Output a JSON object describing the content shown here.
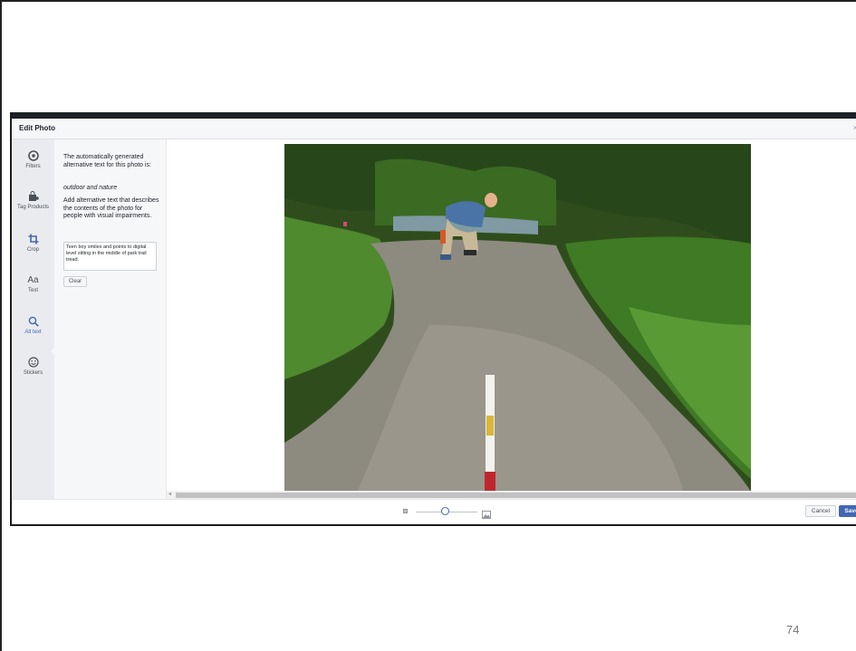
{
  "slide": {
    "number": "74"
  },
  "dialog": {
    "title": "Edit Photo",
    "close_glyph": "×"
  },
  "tools": [
    {
      "label": "Filters",
      "icon": "filters-icon"
    },
    {
      "label": "Tag Products",
      "icon": "shopping-bag-icon"
    },
    {
      "label": "Crop",
      "icon": "crop-icon"
    },
    {
      "label": "Text",
      "icon_text": "Aa",
      "icon": "text-icon"
    },
    {
      "label": "Alt text",
      "icon": "search-icon",
      "active": true
    },
    {
      "label": "Stickers",
      "icon": "smiley-icon"
    }
  ],
  "alt_panel": {
    "intro": "The automatically generated alternative text for this photo is:",
    "generated": "outdoor and nature",
    "instructions": "Add alternative text that describes the contents of the photo for people with visual impairments.",
    "input_value": "Teen boy smiles and points to digital level sitting in the middle of park trail tread.",
    "clear_label": "Clear"
  },
  "footer": {
    "cancel_label": "Cancel",
    "save_label": "Save"
  },
  "colors": {
    "accent": "#4267b2",
    "rail_bg": "#e9ebee",
    "panel_bg": "#f6f7f9"
  }
}
